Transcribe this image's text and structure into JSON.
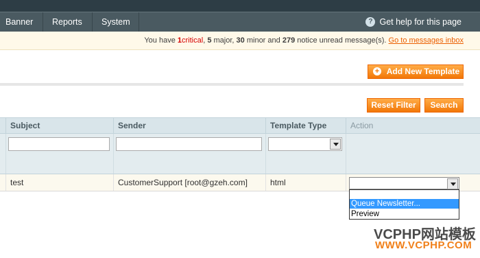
{
  "nav": {
    "items": [
      {
        "label": "Banner"
      },
      {
        "label": "Reports"
      },
      {
        "label": "System"
      }
    ],
    "help_label": "Get help for this page",
    "help_icon": "help-icon"
  },
  "notice": {
    "prefix": "You have",
    "critical_count": "1",
    "critical_word": "critical",
    "major_count": "5",
    "major_word": "major,",
    "minor_count": "30",
    "minor_word": "minor and",
    "notice_count": "279",
    "suffix": "notice unread message(s).",
    "link": "Go to messages inbox"
  },
  "actions": {
    "add_label": "Add New Template",
    "reset_label": "Reset Filter",
    "search_label": "Search"
  },
  "grid": {
    "columns": [
      "Subject",
      "Sender",
      "Template Type",
      "Action"
    ],
    "rows": [
      {
        "subject": "test",
        "sender": "CustomerSupport [root@gzeh.com]",
        "type": "html",
        "action": ""
      }
    ],
    "action_options": [
      "Queue Newsletter...",
      "Preview"
    ]
  },
  "watermark": {
    "line1": "VCPHP网站模板",
    "line2": "WWW.VCPHP.COM"
  },
  "colors": {
    "nav_bg": "#4a5a61",
    "accent": "#f27707",
    "critical": "#d60000",
    "header_bg": "#d9e5ea",
    "highlight": "#3399ff"
  }
}
